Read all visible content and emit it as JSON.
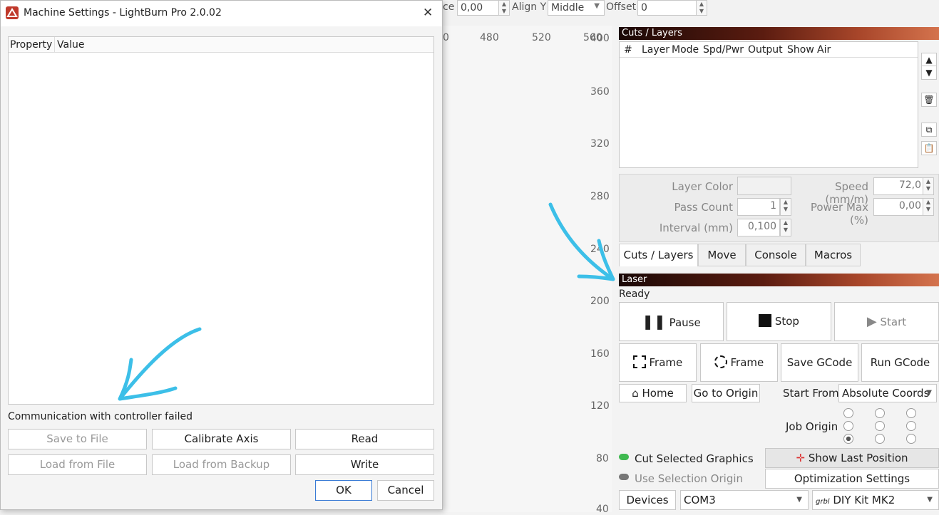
{
  "toolbar": {
    "space_label": "ce",
    "space_value": "0,00",
    "align_y_label": "Align Y",
    "align_y_value": "Middle",
    "offset_label": "Offset",
    "offset_value": "0"
  },
  "ruler": {
    "top": [
      "0",
      "480",
      "520",
      "560"
    ],
    "left": [
      "400",
      "360",
      "320",
      "280",
      "240",
      "200",
      "160",
      "120",
      "80",
      "40"
    ]
  },
  "dialog": {
    "title": "Machine Settings - LightBurn Pro 2.0.02",
    "close_label": "✕",
    "columns": [
      "Property",
      "Value"
    ],
    "status": "Communication with controller failed",
    "buttons": {
      "save_to_file": "Save to File",
      "calibrate_axis": "Calibrate Axis",
      "read": "Read",
      "load_from_file": "Load from File",
      "load_from_backup": "Load from Backup",
      "write": "Write",
      "ok": "OK",
      "cancel": "Cancel"
    }
  },
  "cuts_layers": {
    "title": "Cuts / Layers",
    "columns": [
      "#",
      "Layer",
      "Mode",
      "Spd/Pwr",
      "Output",
      "Show",
      "Air"
    ],
    "layer_color_label": "Layer Color",
    "speed_label": "Speed (mm/m)",
    "speed_value": "72,0",
    "pass_count_label": "Pass Count",
    "pass_count_value": "1",
    "power_max_label": "Power Max (%)",
    "power_max_value": "0,00",
    "interval_label": "Interval (mm)",
    "interval_value": "0,100"
  },
  "tabs": [
    "Cuts / Layers",
    "Move",
    "Console",
    "Macros"
  ],
  "laser": {
    "title": "Laser",
    "status": "Ready",
    "pause": "Pause",
    "stop": "Stop",
    "start": "Start",
    "frame1": "Frame",
    "frame2": "Frame",
    "save_gcode": "Save GCode",
    "run_gcode": "Run GCode",
    "home": "Home",
    "go_to_origin": "Go to Origin",
    "start_from_label": "Start From:",
    "start_from_value": "Absolute Coords",
    "job_origin_label": "Job Origin",
    "cut_selected": "Cut Selected Graphics",
    "use_selection_origin": "Use Selection Origin",
    "show_last_position": "Show Last Position",
    "optimization_settings": "Optimization Settings",
    "devices": "Devices",
    "port": "COM3",
    "device_prefix": "grbl",
    "device": "DIY Kit MK2"
  },
  "colors": {
    "annotation": "#3cbfe8",
    "panel_header": "#5b1c10"
  }
}
